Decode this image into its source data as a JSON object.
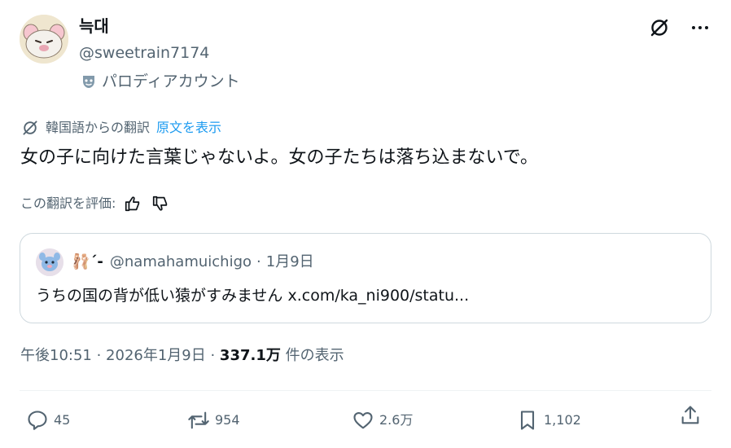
{
  "author": {
    "name": "늑대",
    "handle": "@sweetrain7174",
    "parody_label": "パロディアカウント",
    "avatar_icon": "avatar-mouse-icon"
  },
  "translation": {
    "notice": "韓国語からの翻訳",
    "show_original": "原文を表示",
    "rate_label": "この翻訳を評価:"
  },
  "tweet": {
    "text": "女の子に向けた言葉じゃないよ。女の子たちは落ち込まないで。"
  },
  "quote": {
    "name": "🩰´-",
    "handle": "@namahamuichigo",
    "separator": "·",
    "date": "1月9日",
    "body": "うちの国の背が低い猿がすみません x.com/ka_ni900/statu..."
  },
  "meta": {
    "time": "午後10:51 · 2026年1月9日 · ",
    "views": "337.1万",
    "views_label": " 件の表示"
  },
  "actions": {
    "replies": "45",
    "retweets": "954",
    "likes": "2.6万",
    "bookmarks": "1,102"
  },
  "colors": {
    "accent": "#1d9bf0",
    "secondary_text": "#536471",
    "primary_text": "#0f1419",
    "border": "#cfd9de"
  }
}
